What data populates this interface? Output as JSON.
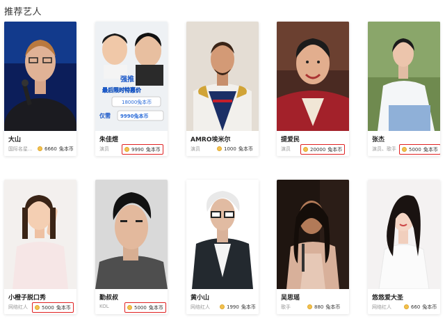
{
  "section_title": "推荐艺人",
  "currency_unit": "兔本币",
  "artists": [
    {
      "name": "大山",
      "role": "国际名星...",
      "price": "6660",
      "highlighted": false
    },
    {
      "name": "朱佳煜",
      "role": "演员",
      "price": "9990",
      "highlighted": true,
      "promo": {
        "tag": "强推",
        "line1": "最后限时特惠价",
        "line2": "18000兔本币",
        "line3_label": "仅需",
        "line3": "9990兔本币"
      }
    },
    {
      "name": "AMRO埃米尔",
      "role": "演员",
      "price": "1000",
      "highlighted": false
    },
    {
      "name": "提爱民",
      "role": "演员",
      "price": "20000",
      "highlighted": true
    },
    {
      "name": "张杰",
      "role": "演员、歌手",
      "price": "5000",
      "highlighted": true
    },
    {
      "name": "小橙子脱口秀",
      "role": "网络红人",
      "price": "5000",
      "highlighted": true
    },
    {
      "name": "勤叔叔",
      "role": "KOL",
      "price": "5000",
      "highlighted": true
    },
    {
      "name": "黄小山",
      "role": "网络红人",
      "price": "1990",
      "highlighted": false
    },
    {
      "name": "吴思瑶",
      "role": "歌手",
      "price": "880",
      "highlighted": false
    },
    {
      "name": "悠悠爱大圣",
      "role": "网络红人",
      "price": "660",
      "highlighted": false
    }
  ],
  "colors": {
    "highlight_border": "#e02020",
    "coin": "#f2c14e"
  }
}
